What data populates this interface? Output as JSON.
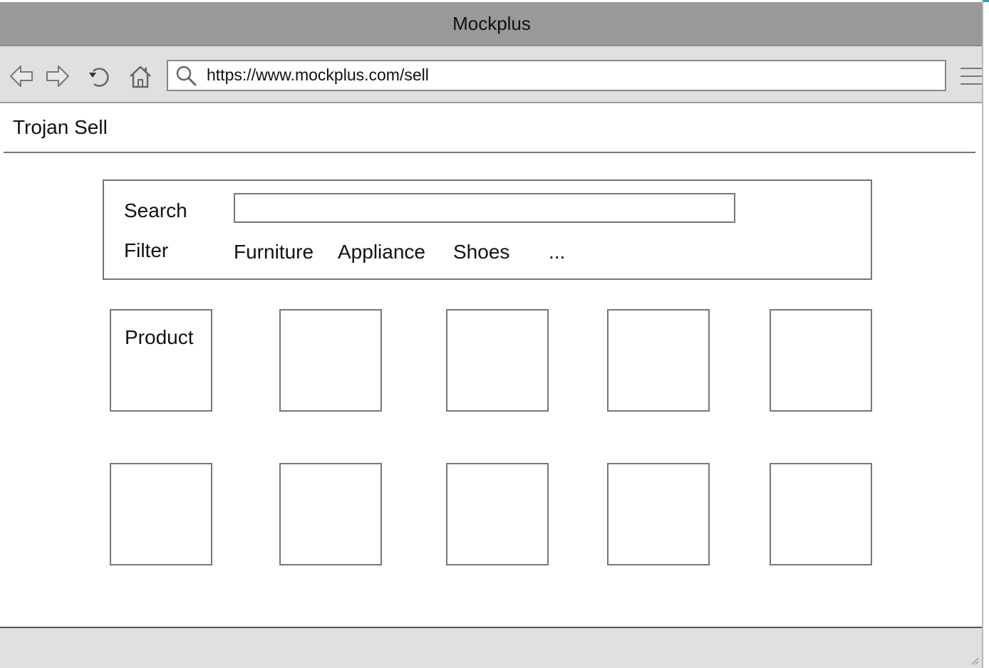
{
  "window": {
    "title": "Mockplus"
  },
  "toolbar": {
    "back_icon": "back-arrow-icon",
    "forward_icon": "forward-arrow-icon",
    "reload_icon": "reload-icon",
    "home_icon": "home-icon",
    "url": "https://www.mockplus.com/sell",
    "menu_icon": "hamburger-menu-icon"
  },
  "page": {
    "site_title": "Trojan Sell",
    "search": {
      "label": "Search",
      "value": "",
      "placeholder": ""
    },
    "filter": {
      "label": "Filter",
      "options": [
        "Furniture",
        "Appliance",
        "Shoes",
        "..."
      ]
    },
    "products": {
      "first_label": "Product",
      "rows": 2,
      "columns": 5
    }
  },
  "colors": {
    "titlebar": "#999999",
    "toolbar": "#e0e0e0",
    "accent": "#2aa3b3",
    "border": "#777777"
  }
}
